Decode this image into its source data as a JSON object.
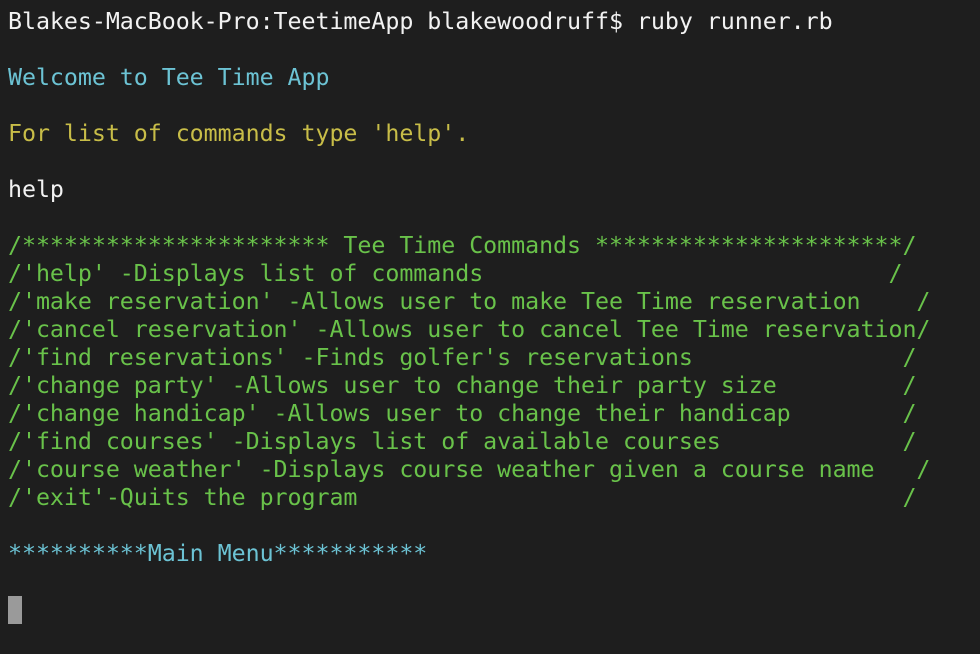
{
  "prompt_line": "Blakes-MacBook-Pro:TeetimeApp blakewoodruff$ ruby runner.rb",
  "welcome": "Welcome to Tee Time App",
  "hint": "For list of commands type 'help'.",
  "user_input": "help",
  "commands_block": [
    "/********************** Tee Time Commands **********************/",
    "/'help' -Displays list of commands                             /",
    "/'make reservation' -Allows user to make Tee Time reservation    /",
    "/'cancel reservation' -Allows user to cancel Tee Time reservation/",
    "/'find reservations' -Finds golfer's reservations               /",
    "/'change party' -Allows user to change their party size         /",
    "/'change handicap' -Allows user to change their handicap        /",
    "/'find courses' -Displays list of available courses             /",
    "/'course weather' -Displays course weather given a course name   /",
    "/'exit'-Quits the program                                       /"
  ],
  "main_menu": "**********Main Menu***********"
}
